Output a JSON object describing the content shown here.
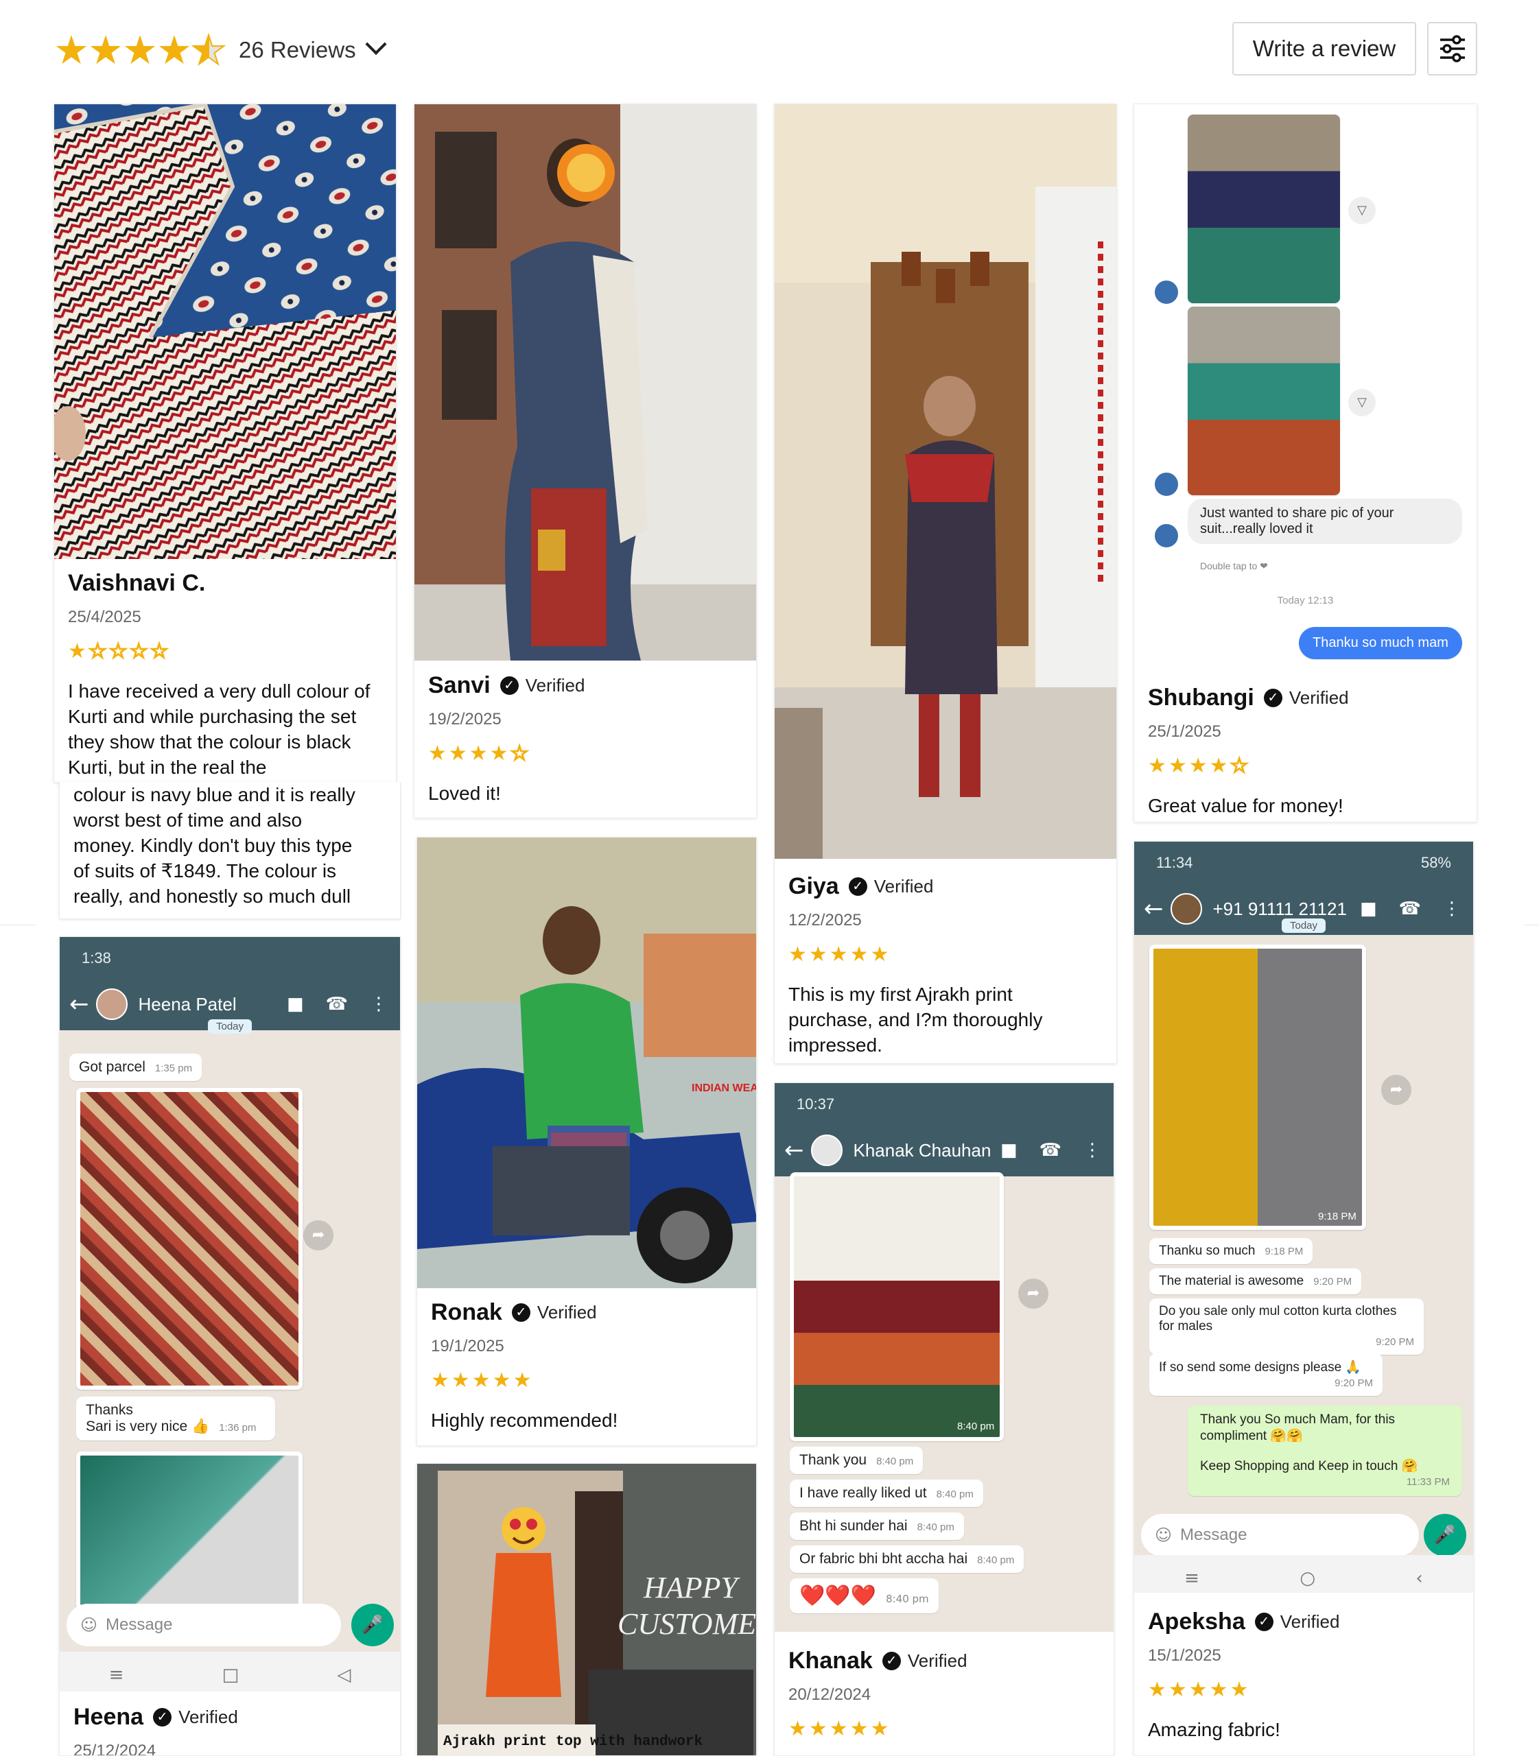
{
  "header": {
    "rating_stars": [
      "★",
      "★",
      "★",
      "★",
      "★"
    ],
    "rating_value": 4.5,
    "review_count": "26 Reviews",
    "write_review_label": "Write a review",
    "filter_icon": "sliders-icon"
  },
  "colors": {
    "star": "#f3b10d",
    "chat_header": "#3f5c66",
    "chat_bg": "#ece5dd",
    "chat_accent": "#00a884"
  },
  "reviews": [
    {
      "name": "Vaishnavi C.",
      "verified": "",
      "date": "25/4/2025",
      "rating": 1,
      "stars": "★",
      "stars_off": "☆☆☆☆",
      "text": "I have received a very dull colour of Kurti and while purchasing the set they show that the colour is black Kurti, but in the real the",
      "text_more": "colour is navy blue and it is really worst best of time and also money. Kindly don't buy this type of suits of ₹1849. The colour is really, and honestly so much dull"
    },
    {
      "name": "Sanvi",
      "verified": "Verified",
      "date": "19/2/2025",
      "rating": 4,
      "stars": "★★★★",
      "stars_off": "☆",
      "text": "Loved it!"
    },
    {
      "name": "Giya",
      "verified": "Verified",
      "date": "12/2/2025",
      "rating": 5,
      "stars": "★★★★★",
      "stars_off": "",
      "text": "This is my first Ajrakh print purchase, and I?m thoroughly impressed."
    },
    {
      "name": "Shubangi",
      "verified": "Verified",
      "date": "25/1/2025",
      "rating": 4,
      "stars": "★★★★",
      "stars_off": "☆",
      "text": "Great value for money!"
    },
    {
      "name": "Ronak",
      "verified": "Verified",
      "date": "19/1/2025",
      "rating": 5,
      "stars": "★★★★★",
      "stars_off": "",
      "text": "Highly recommended!"
    },
    {
      "name": "Apeksha",
      "verified": "Verified",
      "date": "15/1/2025",
      "rating": 5,
      "stars": "★★★★★",
      "stars_off": "",
      "text": "Amazing fabric!"
    },
    {
      "name": "Khanak",
      "verified": "Verified",
      "date": "20/12/2024",
      "rating": 5,
      "stars": "★★★★★",
      "stars_off": ""
    },
    {
      "name": "Heena",
      "verified": "Verified",
      "date": "25/12/2024"
    }
  ],
  "chats": {
    "shubangi": {
      "msg": "Just wanted to share pic of your suit...really loved it",
      "hint": "Double tap to ❤",
      "time": "Today 12:13",
      "reply": "Thanku so much mam"
    },
    "heena": {
      "status_time": "1:38",
      "contact": "Heena Patel",
      "today": "Today",
      "messages": [
        {
          "text": "Got parcel",
          "time": "1:35 pm"
        },
        {
          "text": "Thanks",
          "time": ""
        },
        {
          "text": "Sari is very nice 👍",
          "time": "1:36 pm"
        }
      ],
      "img_time": "1:36 pm",
      "compose": "Message"
    },
    "khanak": {
      "status_time": "10:37",
      "contact": "Khanak Chauhan",
      "img_time": "8:40 pm",
      "messages": [
        {
          "text": "Thank you",
          "time": "8:40 pm"
        },
        {
          "text": "I have really liked ut",
          "time": "8:40 pm"
        },
        {
          "text": "Bht hi sunder hai",
          "time": "8:40 pm"
        },
        {
          "text": "Or fabric bhi bht accha hai",
          "time": "8:40 pm"
        },
        {
          "text": "❤️❤️❤️",
          "time": "8:40 pm"
        }
      ]
    },
    "apeksha": {
      "status_time": "11:34",
      "contact": "+91 91111 21121",
      "today": "Today",
      "battery": "58%",
      "img_time": "9:18 PM",
      "messages": [
        {
          "text": "Thanku so much",
          "time": "9:18 PM"
        },
        {
          "text": "The material is awesome",
          "time": "9:20 PM"
        },
        {
          "text": "Do you sale only mul cotton kurta clothes for males",
          "time": "9:20 PM"
        },
        {
          "text": "If so send some designs please 🙏",
          "time": "9:20 PM"
        }
      ],
      "reply_1": "Thank you So much Mam, for this compliment 🤗🤗",
      "reply_2": "Keep Shopping and Keep in touch 🤗",
      "reply_time": "11:33 PM",
      "compose": "Message"
    }
  },
  "overlay_text": {
    "happy": "HAPPY",
    "customer": "CUSTOMER",
    "caption": "Ajrakh print top with handwork",
    "watermark": "INDIAN WEAVES"
  }
}
